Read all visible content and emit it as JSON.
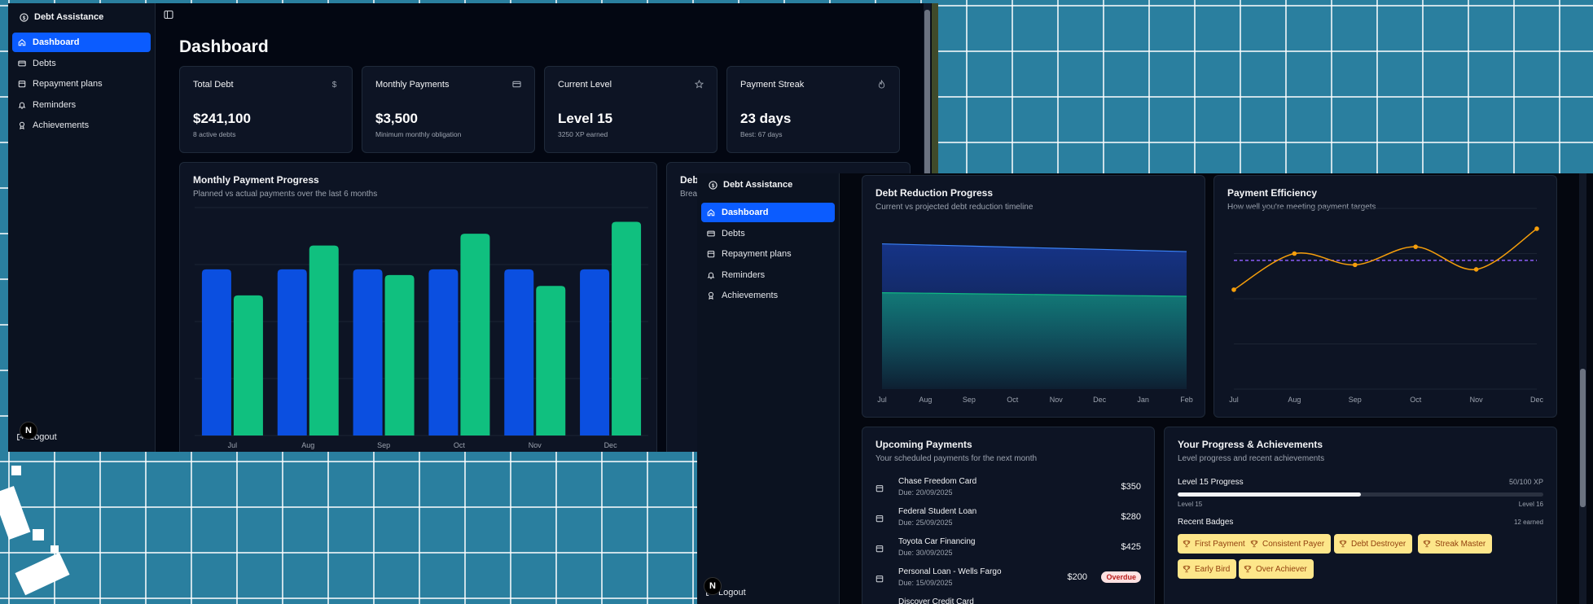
{
  "app": {
    "name": "Debt Assistance",
    "logout_label": "Logout",
    "avatar_initial": "N"
  },
  "sidebar": {
    "items": [
      {
        "label": "Dashboard",
        "icon": "home-icon",
        "active": true
      },
      {
        "label": "Debts",
        "icon": "credit-card-icon"
      },
      {
        "label": "Repayment plans",
        "icon": "calendar-icon"
      },
      {
        "label": "Reminders",
        "icon": "bell-icon"
      },
      {
        "label": "Achievements",
        "icon": "award-icon"
      }
    ]
  },
  "page": {
    "title": "Dashboard"
  },
  "stats": [
    {
      "label": "Total Debt",
      "icon": "dollar-icon",
      "value": "$241,100",
      "sub": "8 active debts"
    },
    {
      "label": "Monthly Payments",
      "icon": "card-icon",
      "value": "$3,500",
      "sub": "Minimum monthly obligation"
    },
    {
      "label": "Current Level",
      "icon": "star-icon",
      "value": "Level 15",
      "sub": "3250 XP earned"
    },
    {
      "label": "Payment Streak",
      "icon": "flame-icon",
      "value": "23 days",
      "sub": "Best: 67 days"
    }
  ],
  "monthly_chart": {
    "title": "Monthly Payment Progress",
    "subtitle": "Planned vs actual payments over the last 6 months"
  },
  "partial_card": {
    "title": "Deb",
    "subtitle": "Brea"
  },
  "debt_reduction": {
    "title": "Debt Reduction Progress",
    "subtitle": "Current vs projected debt reduction timeline"
  },
  "payment_efficiency": {
    "title": "Payment Efficiency",
    "subtitle": "How well you're meeting payment targets"
  },
  "upcoming": {
    "title": "Upcoming Payments",
    "subtitle": "Your scheduled payments for the next month",
    "payments": [
      {
        "name": "Chase Freedom Card",
        "due": "Due: 20/09/2025",
        "amount": "$350"
      },
      {
        "name": "Federal Student Loan",
        "due": "Due: 25/09/2025",
        "amount": "$280"
      },
      {
        "name": "Toyota Car Financing",
        "due": "Due: 30/09/2025",
        "amount": "$425"
      },
      {
        "name": "Personal Loan - Wells Fargo",
        "due": "Due: 15/09/2025",
        "amount": "$200",
        "status": "Overdue"
      },
      {
        "name": "Discover Credit Card",
        "due": "",
        "amount": ""
      }
    ]
  },
  "progress": {
    "title": "Your Progress & Achievements",
    "subtitle": "Level progress and recent achievements",
    "level_label": "Level 15 Progress",
    "xp_label": "50/100 XP",
    "xp_fraction": 0.5,
    "from_level": "Level 15",
    "to_level": "Level 16",
    "badges_label": "Recent Badges",
    "badges_count": "12 earned",
    "badges": [
      "First Payment",
      "Consistent Payer",
      "Debt Destroyer",
      "Streak Master",
      "Early Bird",
      "Over Achiever"
    ]
  },
  "colors": {
    "accent_blue": "#0b5cff",
    "planned_bar": "#0b4fe0",
    "actual_bar": "#10c07f",
    "efficiency_line": "#f59e0b",
    "target_line": "#8b5cf6",
    "badge_bg": "#fde68a"
  },
  "chart_data": [
    {
      "type": "bar",
      "title": "Monthly Payment Progress",
      "categories": [
        "Jul",
        "Aug",
        "Sep",
        "Oct",
        "Nov",
        "Dec"
      ],
      "series": [
        {
          "values": [
            3500,
            3500,
            3500,
            3500,
            3500,
            3500
          ]
        },
        {
          "values": [
            2950,
            4000,
            3380,
            4250,
            3150,
            4500
          ]
        }
      ],
      "ylim": [
        0,
        4800
      ],
      "grid": true
    },
    {
      "type": "area",
      "title": "Debt Reduction Progress",
      "categories": [
        "Jul",
        "Aug",
        "Sep",
        "Oct",
        "Nov",
        "Dec",
        "Jan",
        "Feb"
      ],
      "series": [
        {
          "values": [
            241100,
            239300,
            237500,
            235600,
            233800,
            232000,
            230100,
            228300
          ]
        },
        {
          "values": [
            160000,
            159200,
            158300,
            157500,
            156600,
            155800,
            154900,
            154100
          ]
        }
      ],
      "ylim": [
        0,
        300000
      ],
      "grid": false
    },
    {
      "type": "line",
      "title": "Payment Efficiency",
      "categories": [
        "Jul",
        "Aug",
        "Sep",
        "Oct",
        "Nov",
        "Dec"
      ],
      "series": [
        {
          "values": [
            84,
            100,
            95,
            103,
            93,
            111
          ]
        },
        {
          "values": [
            97,
            97,
            97,
            97,
            97,
            97
          ]
        }
      ],
      "ylim": [
        40,
        120
      ],
      "grid": true
    }
  ]
}
